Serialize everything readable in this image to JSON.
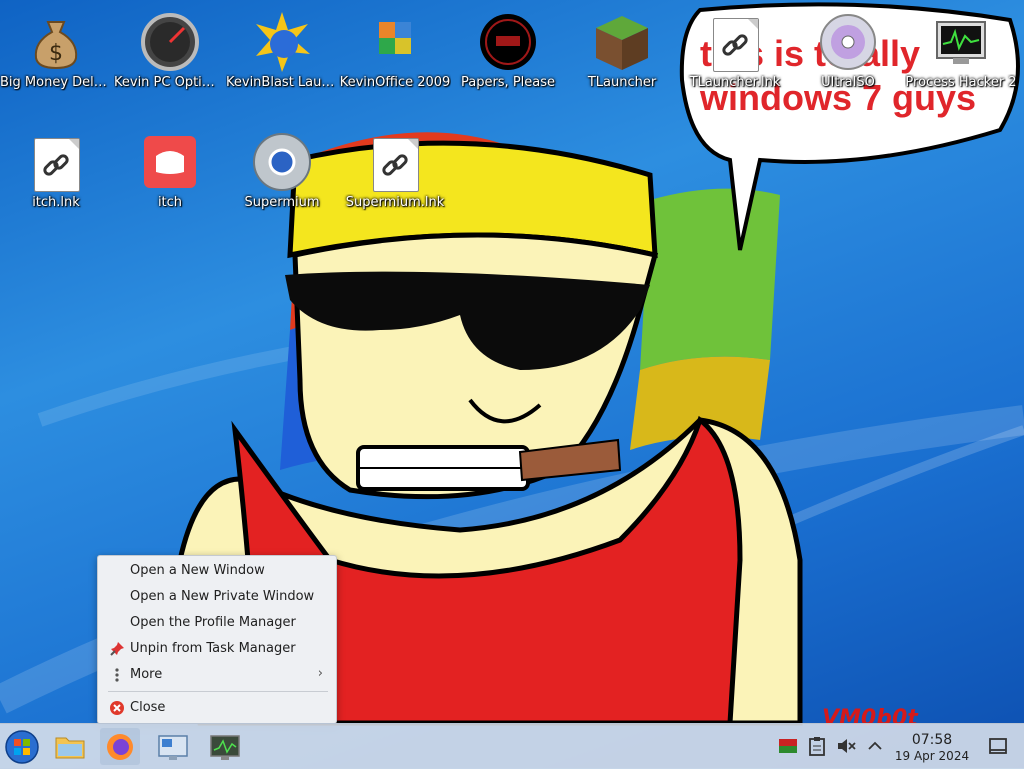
{
  "desktop": {
    "icons": [
      {
        "label": "Big Money Deluxe",
        "icon": "money-bag-icon"
      },
      {
        "label": "Kevin PC Optimizer Ho…",
        "icon": "speedometer-icon"
      },
      {
        "label": "KevinBlast Launcher",
        "icon": "sun-globe-icon"
      },
      {
        "label": "KevinOffice 2009",
        "icon": "office-logo-icon"
      },
      {
        "label": "Papers, Please",
        "icon": "papers-please-seal-icon"
      },
      {
        "label": "TLauncher",
        "icon": "grass-block-icon"
      },
      {
        "label": "TLauncher.lnk",
        "icon": "shortcut-link-icon"
      },
      {
        "label": "UltraISO",
        "icon": "disc-icon"
      },
      {
        "label": "Process Hacker 2",
        "icon": "monitor-graph-icon"
      },
      {
        "label": "itch.lnk",
        "icon": "shortcut-link-icon"
      },
      {
        "label": "itch",
        "icon": "itch-controller-icon"
      },
      {
        "label": "Supermium",
        "icon": "chrome-style-browser-icon"
      },
      {
        "label": "Supermium.lnk",
        "icon": "shortcut-link-icon"
      }
    ]
  },
  "wallpaper": {
    "speech_line1": "this is totally",
    "speech_line2": "windows 7 guys",
    "signature": "VM0b0t"
  },
  "context_menu": {
    "items": [
      {
        "label": "Open a New Window",
        "icon": ""
      },
      {
        "label": "Open a New Private Window",
        "icon": ""
      },
      {
        "label": "Open the Profile Manager",
        "icon": ""
      },
      {
        "label": "Unpin from Task Manager",
        "icon": "unpin-icon"
      },
      {
        "label": "More",
        "icon": "more-vertical-icon",
        "submenu": true
      },
      {
        "label": "Close",
        "icon": "close-icon"
      }
    ]
  },
  "taskbar": {
    "buttons": [
      {
        "name": "start-button",
        "icon": "windows-orb-icon"
      },
      {
        "name": "file-manager",
        "icon": "folder-icon"
      },
      {
        "name": "firefox",
        "icon": "firefox-icon",
        "active": true
      },
      {
        "name": "system-settings",
        "icon": "settings-monitor-icon"
      },
      {
        "name": "system-monitor",
        "icon": "system-monitor-icon"
      }
    ],
    "tray": {
      "icons": [
        "flag-icon",
        "clipboard-icon",
        "volume-muted-icon",
        "chevron-up-icon"
      ],
      "time": "07:58",
      "date": "19 Apr 2024"
    }
  },
  "colors": {
    "desktop_blue": "#1a6fd0",
    "taskbar": "#dce1eb",
    "menu_bg": "#eef0f3",
    "speech_red": "#e0262b"
  }
}
